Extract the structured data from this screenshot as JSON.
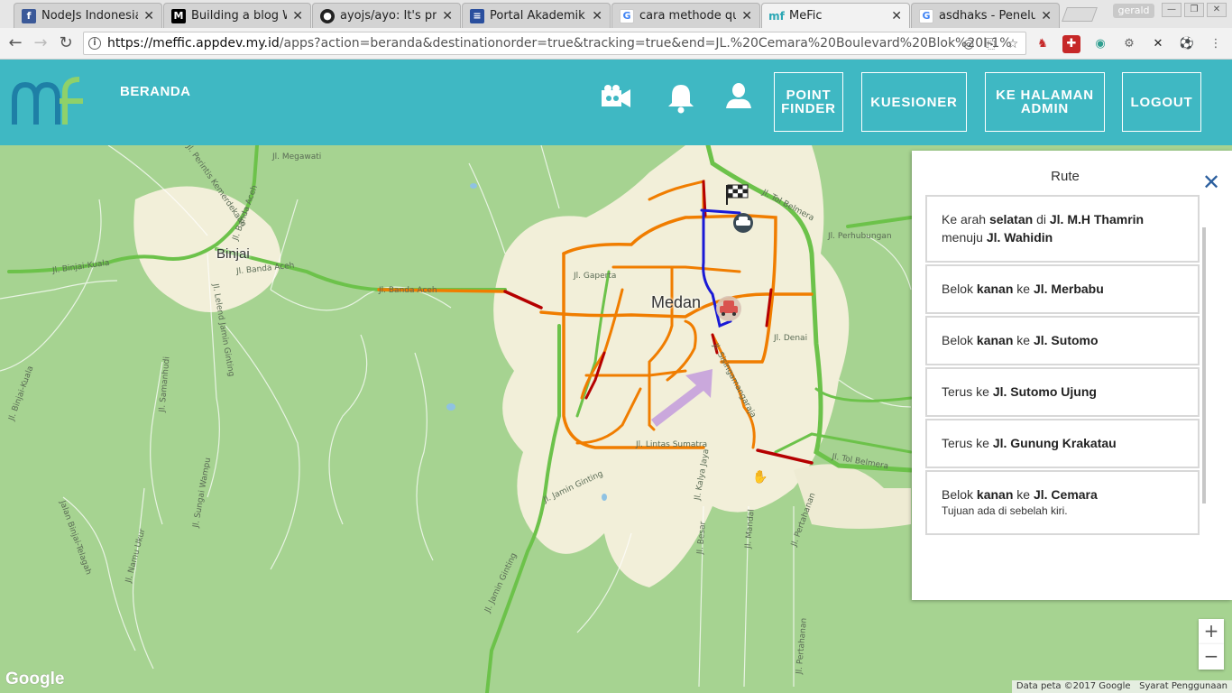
{
  "browser": {
    "tabs": [
      {
        "title": "NodeJs Indonesia",
        "favicon": "facebook-icon",
        "color": "#3b5998",
        "glyph": "f"
      },
      {
        "title": "Building a blog With",
        "favicon": "medium-icon",
        "color": "#000000",
        "glyph": "M"
      },
      {
        "title": "ayojs/ayo: It's prom",
        "favicon": "github-icon",
        "color": "#222222",
        "glyph": "●"
      },
      {
        "title": "Portal Akademik M",
        "favicon": "portal-icon",
        "color": "#2a4f9e",
        "glyph": "≡"
      },
      {
        "title": "cara methode quer",
        "favicon": "google-icon",
        "color": "#4285f4",
        "glyph": "G"
      },
      {
        "title": "MeFic",
        "favicon": "mefic-icon",
        "color": "#2aa6b4",
        "glyph": "mf"
      },
      {
        "title": "asdhaks - Penelust",
        "favicon": "google-icon",
        "color": "#4285f4",
        "glyph": "G"
      }
    ],
    "active_tab": 5,
    "user_chip": "gerald",
    "url_host": "https://meffic.appdev.my.id",
    "url_rest": "/apps?action=beranda&destinationorder=true&tracking=true&end=JL.%20Cemara%20Boulevard%20Blok%20I-1%"
  },
  "app": {
    "nav_label": "BERANDA",
    "buttons": {
      "point_finder": "POINT FINDER",
      "kuesioner": "KUESIONER",
      "admin": "KE HALAMAN ADMIN",
      "logout": "LOGOUT"
    }
  },
  "map": {
    "city_labels": {
      "binjai": "Binjai",
      "medan": "Medan"
    },
    "street_labels": {
      "megawati": "Jl. Megawati",
      "perintis": "Jl. Perintis Kemerdekaan",
      "banda_aceh_1": "Jl. Banda Aceh",
      "banda_aceh_2": "Jl. Banda Aceh",
      "banda_aceh_3": "Jl. Banda Aceh",
      "binjai_kuala": "Jl. Binjai-Kuala",
      "binjai_kuala_2": "Jl. Binjai-Kuala",
      "lelend": "Jl. Lelend Jamin Ginting",
      "samanhudi": "Jl. Samanhudi",
      "sungai_wampu": "Jl. Sungai Wampu",
      "namu_ukur": "Jl. Namu Ukur",
      "namu_ukur2": "Jl. Namu Ukur",
      "binjai_telagah": "Jalan Binjai-Telagah",
      "gaperta": "Jl. Gaperta",
      "tol_belmera_1": "Jl. Tol Belmera",
      "tol_belmera_2": "Jl. Tol Belmera",
      "perhubungan": "Jl. Perhubungan",
      "denai": "Jl. Denai",
      "sisingamangaraja": "Jl. Sisingamangaraja",
      "lintas_sumatra": "Jl. Lintas Sumatra",
      "jamin_ginting": "Jl. Jamin Ginting",
      "jamin_ginting2": "Jl. Jamin Ginting",
      "kalya_jaya": "Jl. Kalya Jaya",
      "besar": "Jl. Besar",
      "mandal": "Jl. Mandal",
      "pertahanan": "Jl. Pertahanan",
      "pertahanan2": "Jl. Pertahanan"
    },
    "google_logo": "Google",
    "attribution": "Data peta ©2017 Google",
    "terms": "Syarat Penggunaan",
    "zoom_in": "+",
    "zoom_out": "−",
    "colors": {
      "fast": "#6cc24a",
      "medium": "#f07d00",
      "slow": "#b50000",
      "route": "#1a1ad6"
    }
  },
  "route_panel": {
    "title": "Rute",
    "close": "✕",
    "steps": [
      {
        "p1": "Ke arah ",
        "b1": "selatan",
        "p2": " di ",
        "b2": "Jl. M.H Thamrin",
        "p3": " menuju ",
        "b3": "Jl. Wahidin",
        "sub": ""
      },
      {
        "p1": "Belok ",
        "b1": "kanan",
        "p2": " ke ",
        "b2": "Jl. Merbabu",
        "p3": "",
        "b3": "",
        "sub": ""
      },
      {
        "p1": "Belok ",
        "b1": "kanan",
        "p2": " ke ",
        "b2": "Jl. Sutomo",
        "p3": "",
        "b3": "",
        "sub": ""
      },
      {
        "p1": "Terus ke ",
        "b1": "Jl. Sutomo Ujung",
        "p2": "",
        "b2": "",
        "p3": "",
        "b3": "",
        "sub": ""
      },
      {
        "p1": "Terus ke ",
        "b1": "Jl. Gunung Krakatau",
        "p2": "",
        "b2": "",
        "p3": "",
        "b3": "",
        "sub": ""
      },
      {
        "p1": "Belok ",
        "b1": "kanan",
        "p2": " ke ",
        "b2": "Jl. Cemara",
        "p3": "",
        "b3": "",
        "sub": "Tujuan ada di sebelah kiri."
      }
    ]
  }
}
